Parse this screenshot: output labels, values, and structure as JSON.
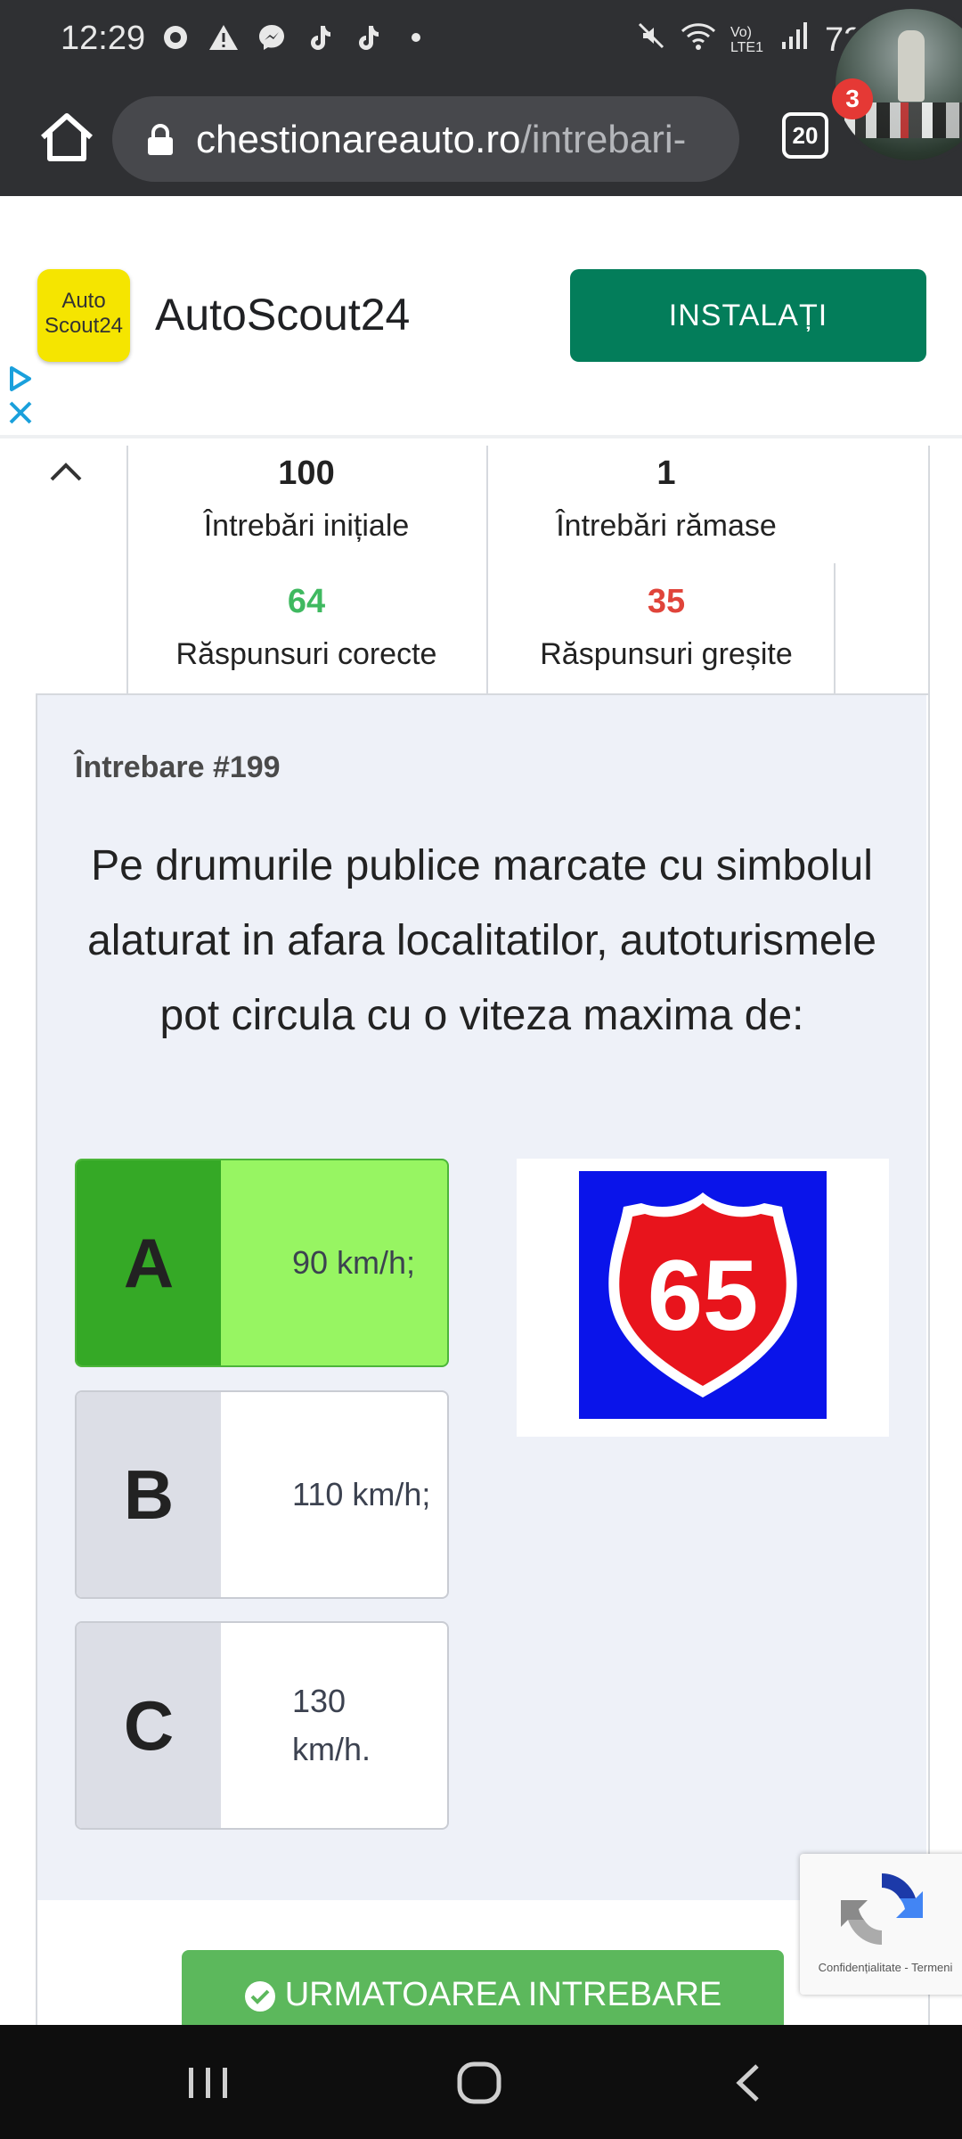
{
  "status_bar": {
    "time": "12:29",
    "battery": "73%",
    "network": "Vo) LTE1",
    "left_icons": [
      "record-icon",
      "warning-icon",
      "messenger-icon",
      "tiktok-icon",
      "tiktok-icon",
      "dot-icon"
    ],
    "right_icons": [
      "mute-icon",
      "wifi-icon",
      "signal-icon",
      "battery-icon"
    ]
  },
  "browser": {
    "url_domain": "chestionareauto.ro",
    "url_path": "/intrebari-",
    "tab_count": "20",
    "notification_count": "3"
  },
  "ad": {
    "app_name": "AutoScout24",
    "logo_line1": "Auto",
    "logo_line2": "Scout24",
    "install_label": "INSTALAȚI",
    "logo_color": "#f5e500",
    "button_color": "#037d5a"
  },
  "stats": {
    "initial_count": "100",
    "initial_label": "Întrebări inițiale",
    "remaining_count": "1",
    "remaining_label": "Întrebări rămase",
    "correct_count": "64",
    "correct_label": "Răspunsuri corecte",
    "wrong_count": "35",
    "wrong_label": "Răspunsuri greșite"
  },
  "question": {
    "number_label": "Întrebare #199",
    "text": "Pe drumurile publice marcate cu simbolul alaturat in afara localitatilor, autoturismele pot circula cu o viteza maxima de:",
    "answers": [
      {
        "letter": "A",
        "text": "90 km/h;",
        "state": "correct"
      },
      {
        "letter": "B",
        "text": "110 km/h;",
        "state": "default"
      },
      {
        "letter": "C",
        "text": "130 km/h.",
        "state": "default"
      }
    ],
    "sign_number": "65",
    "sign_colors": {
      "background": "#0a14ea",
      "shield": "#e8141c",
      "text": "#ffffff"
    }
  },
  "next_button": {
    "label": "URMATOAREA INTREBARE"
  },
  "recaptcha": {
    "footer": "Confidențialitate - Termeni"
  },
  "nav": {
    "icons": [
      "recent-apps-icon",
      "home-nav-icon",
      "back-nav-icon"
    ]
  }
}
